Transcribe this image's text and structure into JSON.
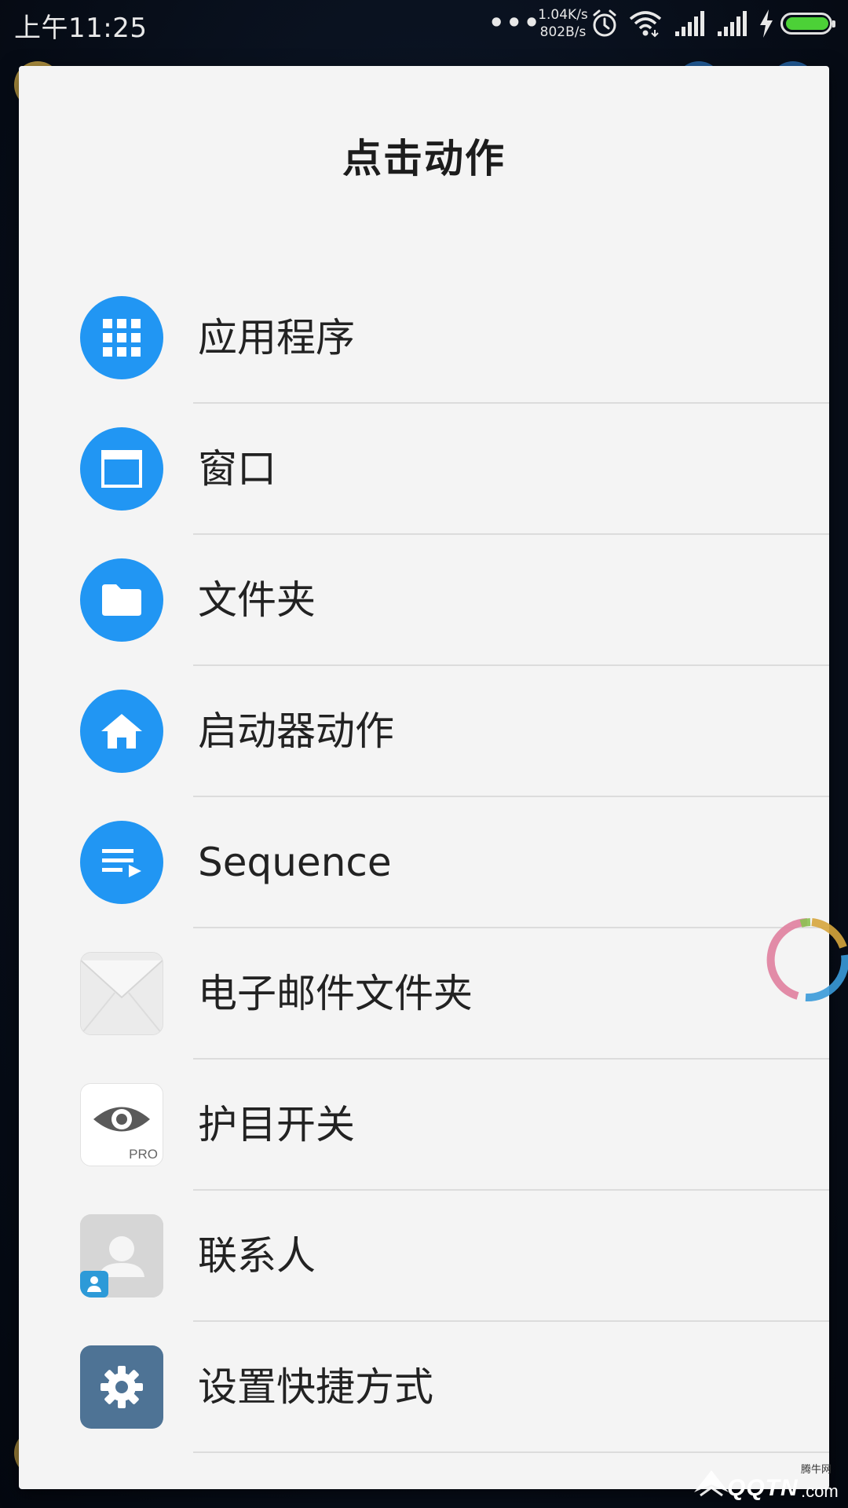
{
  "status_bar": {
    "time": "上午11:25",
    "more_dots": "•••",
    "net_speed_up": "1.04K/s",
    "net_speed_down": "802B/s",
    "battery_level": 1.0,
    "battery_color": "#4cd137"
  },
  "dialog": {
    "title": "点击动作",
    "items": [
      {
        "label": "应用程序",
        "icon": "apps-grid-icon"
      },
      {
        "label": "窗口",
        "icon": "window-icon"
      },
      {
        "label": "文件夹",
        "icon": "folder-icon"
      },
      {
        "label": "启动器动作",
        "icon": "home-icon"
      },
      {
        "label": "Sequence",
        "icon": "playlist-icon"
      },
      {
        "label": "电子邮件文件夹",
        "icon": "envelope-icon"
      },
      {
        "label": "护目开关",
        "icon": "eye-pro-icon",
        "badge": "PRO"
      },
      {
        "label": "联系人",
        "icon": "contact-icon"
      },
      {
        "label": "设置快捷方式",
        "icon": "gear-icon"
      }
    ]
  },
  "watermark": {
    "brand": "QQTN",
    "suffix": ".com",
    "small_text": "腾牛网"
  },
  "colors": {
    "accent_blue": "#2196f3",
    "dialog_bg": "#f4f4f4",
    "settings_tile": "#4e7395"
  }
}
